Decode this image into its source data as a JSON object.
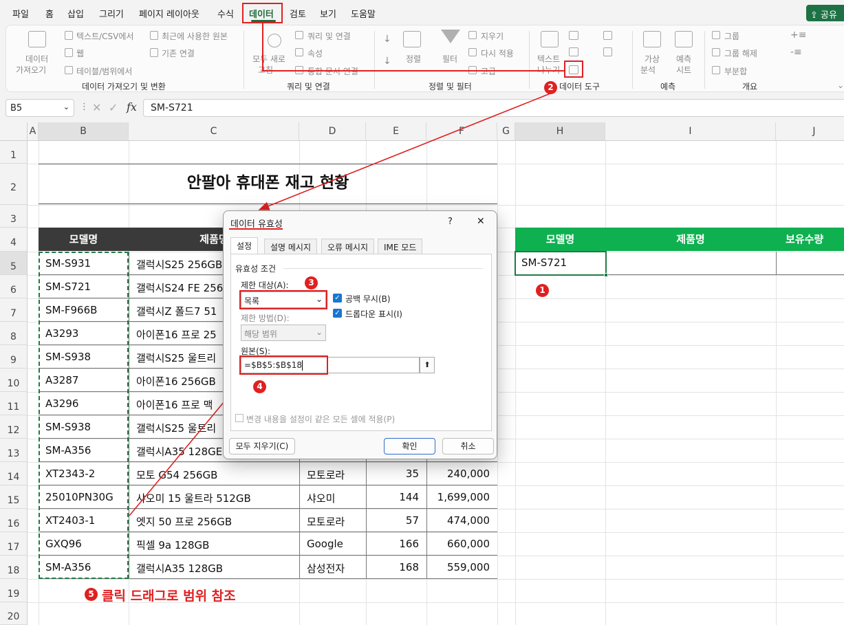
{
  "menu": {
    "tabs": [
      "파일",
      "홈",
      "삽입",
      "그리기",
      "페이지 레이아웃",
      "수식",
      "데이터",
      "검토",
      "보기",
      "도움말"
    ],
    "share": "공유"
  },
  "ribbon": {
    "get_data": {
      "btn1": "데이터",
      "btn2": "가져오기",
      "text_csv": "텍스트/CSV에서",
      "web": "웹",
      "table_range": "테이블/범위에서",
      "recent": "최근에 사용한 원본",
      "existing": "기존 연결",
      "label": "데이터 가져오기 및 변환"
    },
    "queries": {
      "refresh1": "모두 새로",
      "refresh2": "고침",
      "queries_conn": "쿼리 및 연결",
      "properties": "속성",
      "links": "통합 문서 연결",
      "label": "쿼리 및 연결"
    },
    "sort": {
      "sort": "정렬",
      "filter": "필터",
      "clear": "지우기",
      "reapply": "다시 적용",
      "advanced": "고급",
      "label": "정렬 및 필터"
    },
    "tools": {
      "text1": "텍스트",
      "text2": "나누기",
      "label": "데이터 도구"
    },
    "forecast": {
      "whatif1": "가상",
      "whatif2": "분석",
      "sheet1": "예측",
      "sheet2": "시트",
      "label": "예측"
    },
    "outline": {
      "group": "그룹",
      "ungroup": "그룹 해제",
      "subtotal": "부분합",
      "label": "개요"
    }
  },
  "formula_bar": {
    "name_box": "B5",
    "value": "SM-S721"
  },
  "columns": [
    "A",
    "B",
    "C",
    "D",
    "E",
    "F",
    "G",
    "H",
    "I",
    "J"
  ],
  "rows": [
    "1",
    "2",
    "3",
    "4",
    "5",
    "6",
    "7",
    "8",
    "9",
    "10",
    "11",
    "12",
    "13",
    "14",
    "15",
    "16",
    "17",
    "18",
    "19",
    "20"
  ],
  "sheet": {
    "title": "안팔아 휴대폰 재고 현황",
    "headers": {
      "model": "모델명",
      "product": "제품명"
    },
    "table": [
      {
        "model": "SM-S931",
        "product": "갤럭시S25 256GB",
        "maker": "",
        "qty": "",
        "price": ""
      },
      {
        "model": "SM-S721",
        "product": "갤럭시S24 FE 256",
        "maker": "",
        "qty": "",
        "price": ""
      },
      {
        "model": "SM-F966B",
        "product": "갤럭시Z 폴드7 51",
        "maker": "",
        "qty": "",
        "price": ""
      },
      {
        "model": "A3293",
        "product": "아이폰16 프로 25",
        "maker": "",
        "qty": "",
        "price": ""
      },
      {
        "model": "SM-S938",
        "product": "갤럭시S25 울트리",
        "maker": "",
        "qty": "",
        "price": ""
      },
      {
        "model": "A3287",
        "product": "아이폰16 256GB",
        "maker": "",
        "qty": "",
        "price": ""
      },
      {
        "model": "A3296",
        "product": "아이폰16 프로 맥",
        "maker": "",
        "qty": "",
        "price": ""
      },
      {
        "model": "SM-S938",
        "product": "갤럭시S25 울트리",
        "maker": "",
        "qty": "",
        "price": ""
      },
      {
        "model": "SM-A356",
        "product": "갤럭시A35 128GE",
        "maker": "",
        "qty": "",
        "price": ""
      },
      {
        "model": "XT2343-2",
        "product": "모토 G54 256GB",
        "maker": "모토로라",
        "qty": "35",
        "price": "240,000"
      },
      {
        "model": "25010PN30G",
        "product": "샤오미 15 울트라 512GB",
        "maker": "샤오미",
        "qty": "144",
        "price": "1,699,000"
      },
      {
        "model": "XT2403-1",
        "product": "엣지 50 프로 256GB",
        "maker": "모토로라",
        "qty": "57",
        "price": "474,000"
      },
      {
        "model": "GXQ96",
        "product": "픽셀 9a 128GB",
        "maker": "Google",
        "qty": "166",
        "price": "660,000"
      },
      {
        "model": "SM-A356",
        "product": "갤럭시A35 128GB",
        "maker": "삼성전자",
        "qty": "168",
        "price": "559,000"
      }
    ],
    "lookup": {
      "h_model": "모델명",
      "h_product": "제품명",
      "h_qty": "보유수량",
      "value": "SM-S721"
    },
    "annotation5": "클릭 드래그로 범위 참조"
  },
  "dialog": {
    "title": "데이터 유효성",
    "help": "?",
    "close": "✕",
    "tabs": [
      "설정",
      "설명 메시지",
      "오류 메시지",
      "IME 모드"
    ],
    "section": "유효성 조건",
    "allow_label": "제한 대상(A):",
    "allow_value": "목록",
    "ignore_blank": "공백 무시(B)",
    "dropdown": "드롭다운 표시(I)",
    "data_label": "제한 방법(D):",
    "data_value": "해당 범위",
    "source_label": "원본(S):",
    "source_value": "=$B$5:$B$18",
    "apply_all": "변경 내용을 설정이 같은 모든 셀에 적용(P)",
    "clear_all": "모두 지우기(C)",
    "ok": "확인",
    "cancel": "취소"
  },
  "badges": [
    "1",
    "2",
    "3",
    "4",
    "5"
  ],
  "colors": {
    "accent": "#1e6b3c",
    "annotation": "#e02020",
    "green_header": "#0fb050",
    "dark_header": "#3a3a3a"
  }
}
